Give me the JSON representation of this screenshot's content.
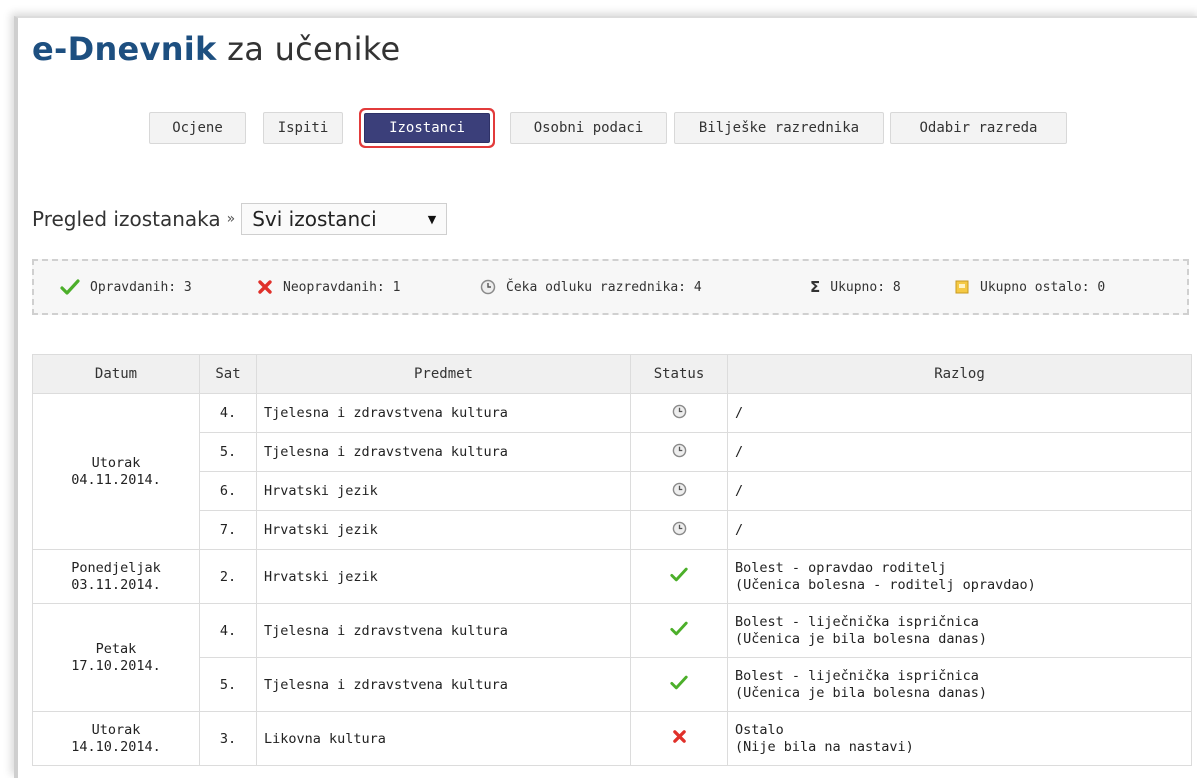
{
  "app": {
    "brand": "e-Dnevnik",
    "title_rest": " za učenike"
  },
  "tabs": [
    {
      "label": "Ocjene",
      "active": false
    },
    {
      "label": "Ispiti",
      "active": false
    },
    {
      "label": "Izostanci",
      "active": true
    },
    {
      "label": "Osobni podaci",
      "active": false
    },
    {
      "label": "Bilješke razrednika",
      "active": false
    },
    {
      "label": "Odabir razreda",
      "active": false
    }
  ],
  "overview": {
    "label": "Pregled izostanaka",
    "separator": "»",
    "filter_value": "Svi izostanci"
  },
  "summary": {
    "excused": "Opravdanih: 3",
    "unexcused": "Neopravdanih: 1",
    "pending": "Čeka odluku razrednika: 4",
    "total": "Ukupno: 8",
    "other_total": "Ukupno ostalo: 0"
  },
  "table": {
    "headers": {
      "date": "Datum",
      "hour": "Sat",
      "subject": "Predmet",
      "status": "Status",
      "reason": "Razlog"
    },
    "groups": [
      {
        "day": "Utorak",
        "date": "04.11.2014."
      },
      {
        "day": "Ponedjeljak",
        "date": "03.11.2014."
      },
      {
        "day": "Petak",
        "date": "17.10.2014."
      },
      {
        "day": "Utorak",
        "date": "14.10.2014."
      }
    ],
    "rows": [
      {
        "hour": "4.",
        "subject": "Tjelesna i zdravstvena kultura",
        "status": "pending",
        "reason1": "/",
        "reason2": ""
      },
      {
        "hour": "5.",
        "subject": "Tjelesna i zdravstvena kultura",
        "status": "pending",
        "reason1": "/",
        "reason2": ""
      },
      {
        "hour": "6.",
        "subject": "Hrvatski jezik",
        "status": "pending",
        "reason1": "/",
        "reason2": ""
      },
      {
        "hour": "7.",
        "subject": "Hrvatski jezik",
        "status": "pending",
        "reason1": "/",
        "reason2": ""
      },
      {
        "hour": "2.",
        "subject": "Hrvatski jezik",
        "status": "excused",
        "reason1": "Bolest - opravdao roditelj",
        "reason2": "(Učenica bolesna - roditelj opravdao)"
      },
      {
        "hour": "4.",
        "subject": "Tjelesna i zdravstvena kultura",
        "status": "excused",
        "reason1": "Bolest - liječnička ispričnica",
        "reason2": "(Učenica je bila bolesna danas)"
      },
      {
        "hour": "5.",
        "subject": "Tjelesna i zdravstvena kultura",
        "status": "excused",
        "reason1": "Bolest - liječnička ispričnica",
        "reason2": "(Učenica je bila bolesna danas)"
      },
      {
        "hour": "3.",
        "subject": "Likovna kultura",
        "status": "unexcused",
        "reason1": "Ostalo",
        "reason2": "(Nije bila na nastavi)"
      }
    ]
  },
  "colors": {
    "brand": "#1d4f80",
    "active_tab": "#3b3f7a",
    "active_tab_outline": "#e23b3b",
    "check": "#4caf2a",
    "cross": "#e0302a",
    "clock": "#8a8a8a"
  },
  "icons": {
    "excused": "check-icon",
    "unexcused": "cross-icon",
    "pending": "clock-icon",
    "total": "sigma-icon",
    "other": "note-icon"
  }
}
